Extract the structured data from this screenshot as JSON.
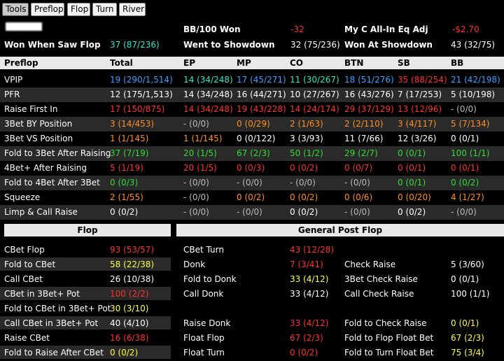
{
  "tabs": [
    "Tools",
    "Preflop",
    "Flop",
    "Turn",
    "River"
  ],
  "active_tab": "Tools",
  "summary": {
    "bb100_label": "BB/100  Won",
    "bb100_value": "-32",
    "allin_label": "My C All-In Eq Adj",
    "allin_value": "-$2.70",
    "wwsf_label": "Won When Saw Flop",
    "wwsf_value": "37 (87/236)",
    "wtsd_label": "Went to Showdown",
    "wtsd_value": "32 (75/236)",
    "wsd_label": "Won At Showdown",
    "wsd_value": "43 (32/75)"
  },
  "preflop_headers": [
    "Preflop",
    "Total",
    "EP",
    "MP",
    "CO",
    "BTN",
    "SB",
    "BB"
  ],
  "preflop_rows": [
    {
      "label": "VPIP",
      "cells": [
        "19 (290/1,514)",
        "14 (34/248)",
        "17 (45/271)",
        "11 (30/267)",
        "18 (51/276)",
        "35 (88/254)",
        "21 (42/198)"
      ]
    },
    {
      "label": "PFR",
      "cells": [
        "12 (175/1,513)",
        "14 (34/248)",
        "16 (44/271)",
        "10 (27/267)",
        "16 (43/276)",
        "7 (17/253)",
        "5 (10/198)"
      ]
    },
    {
      "label": "Raise First In",
      "cells": [
        "17 (150/875)",
        "14 (34/248)",
        "19 (43/228)",
        "14 (24/174)",
        "29 (37/129)",
        "13 (12/96)",
        "- (0/0)"
      ]
    },
    {
      "label": "3Bet BY Position",
      "cells": [
        "3 (14/453)",
        "- (0/0)",
        "0 (0/29)",
        "2 (1/63)",
        "2 (2/110)",
        "3 (4/117)",
        "5 (7/134)"
      ]
    },
    {
      "label": "3Bet VS Position",
      "cells": [
        "1 (1/145)",
        "1 (1/145)",
        "0 (0/122)",
        "3 (3/93)",
        "11 (7/66)",
        "12 (3/26)",
        "0 (0/1)"
      ]
    },
    {
      "label": "Fold to 3Bet After Raising",
      "cells": [
        "37 (7/19)",
        "20 (1/5)",
        "67 (2/3)",
        "50 (1/2)",
        "29 (2/7)",
        "0 (0/1)",
        "100 (1/1)"
      ]
    },
    {
      "label": "4Bet+ After Raising",
      "cells": [
        "5 (1/19)",
        "20 (1/5)",
        "0 (0/3)",
        "0 (0/2)",
        "0 (0/7)",
        "0 (0/1)",
        "0 (0/1)"
      ]
    },
    {
      "label": "Fold to 4Bet After 3Bet",
      "cells": [
        "0 (0/3)",
        "- (0/0)",
        "- (0/0)",
        "- (0/0)",
        "- (0/0)",
        "0 (0/1)",
        "0 (0/2)"
      ]
    },
    {
      "label": "Squeeze",
      "cells": [
        "2 (1/55)",
        "- (0/0)",
        "0 (0/2)",
        "0 (0/2)",
        "0 (0/6)",
        "0 (0/20)",
        "4 (1/27)"
      ]
    },
    {
      "label": "Limp & Call Raise",
      "cells": [
        "0 (0/2)",
        "- (0/0)",
        "- (0/0)",
        "0 (0/2)",
        "- (0/0)",
        "0 (0/2)",
        "- (0/0)"
      ]
    }
  ],
  "preflop_colors": [
    [
      "#3aa0ff",
      "#2ee8c8",
      "#3aa0ff",
      "#2ee8c8",
      "#3aa0ff",
      "#ff3030",
      "#3aa0ff"
    ],
    [
      "#ffffff",
      "#ffffff",
      "#ffffff",
      "#ffffff",
      "#ffffff",
      "#ffffff",
      "#ffffff"
    ],
    [
      "#ff3030",
      "#ff3030",
      "#ff3030",
      "#ff3030",
      "#ff3030",
      "#ff3030",
      "#bbbbbb"
    ],
    [
      "#ff9020",
      "#bbbbbb",
      "#ff9020",
      "#ff9020",
      "#ff9020",
      "#ff9020",
      "#ff9020"
    ],
    [
      "#ff9020",
      "#ff9020",
      "#ffffff",
      "#ffffff",
      "#ffffff",
      "#ffffff",
      "#ffffff"
    ],
    [
      "#33dd33",
      "#33dd33",
      "#33dd33",
      "#33dd33",
      "#33dd33",
      "#33dd33",
      "#33dd33"
    ],
    [
      "#ff3030",
      "#ff3030",
      "#ff3030",
      "#ff3030",
      "#ff3030",
      "#ff3030",
      "#ff3030"
    ],
    [
      "#33dd33",
      "#bbbbbb",
      "#bbbbbb",
      "#bbbbbb",
      "#bbbbbb",
      "#33dd33",
      "#33dd33"
    ],
    [
      "#ff9020",
      "#bbbbbb",
      "#ff9020",
      "#ff9020",
      "#ff9020",
      "#ff9020",
      "#ff9020"
    ],
    [
      "#ffffff",
      "#bbbbbb",
      "#bbbbbb",
      "#ffffff",
      "#bbbbbb",
      "#ffffff",
      "#bbbbbb"
    ]
  ],
  "flop_header": "Flop",
  "general_header": "General Post Flop",
  "flop_rows": [
    {
      "label": "CBet Flop",
      "value": "93 (53/57)",
      "color": "#ff3030"
    },
    {
      "label": "Fold to CBet",
      "value": "58 (22/38)",
      "color": "#ffff40"
    },
    {
      "label": "Call CBet",
      "value": "26 (10/38)",
      "color": "#ffffff"
    },
    {
      "label": "CBet in 3Bet+ Pot",
      "value": "100 (2/2)",
      "color": "#ff3030"
    },
    {
      "label": "Fold to CBet in 3Bet+ Pot",
      "value": "30 (3/10)",
      "color": "#ffff40"
    },
    {
      "label": "Call CBet in 3Bet+ Pot",
      "value": "40 (4/10)",
      "color": "#ffffff"
    },
    {
      "label": "Raise CBet",
      "value": "16 (6/38)",
      "color": "#ff3030"
    },
    {
      "label": "Fold to Raise After CBet",
      "value": "0 (0/2)",
      "color": "#ffff40"
    }
  ],
  "general_col1": [
    {
      "label": "CBet Turn",
      "value": "43 (12/28)",
      "color": "#ff3030"
    },
    {
      "label": "Donk",
      "value": "7 (3/41)",
      "color": "#ff3030"
    },
    {
      "label": "Fold to Donk",
      "value": "33 (4/12)",
      "color": "#ffff40"
    },
    {
      "label": "Call Donk",
      "value": "33 (4/12)",
      "color": "#ffffff"
    },
    {
      "label": "",
      "value": "",
      "color": "#ffffff"
    },
    {
      "label": "Raise Donk",
      "value": "33 (4/12)",
      "color": "#ff3030"
    },
    {
      "label": "Float Flop",
      "value": "67 (2/3)",
      "color": "#ff3030"
    },
    {
      "label": "Float Turn",
      "value": "0 (0/2)",
      "color": "#ff3030"
    }
  ],
  "general_col2": [
    {
      "label": "",
      "value": "",
      "color": "#ffffff"
    },
    {
      "label": "Check Raise",
      "value": "5 (3/60)",
      "color": "#ffffff"
    },
    {
      "label": "3Bet Check Raise",
      "value": "0 (0/1)",
      "color": "#ffffff"
    },
    {
      "label": "Call Check Raise",
      "value": "100 (1/1)",
      "color": "#ffffff"
    },
    {
      "label": "",
      "value": "",
      "color": "#ffffff"
    },
    {
      "label": "Fold to Check Raise",
      "value": "0 (0/1)",
      "color": "#ffff40"
    },
    {
      "label": "Fold to Flop Float Bet",
      "value": "67 (2/3)",
      "color": "#ffff40"
    },
    {
      "label": "Fold to Turn Float Bet",
      "value": "75 (3/4)",
      "color": "#ffff40"
    }
  ]
}
